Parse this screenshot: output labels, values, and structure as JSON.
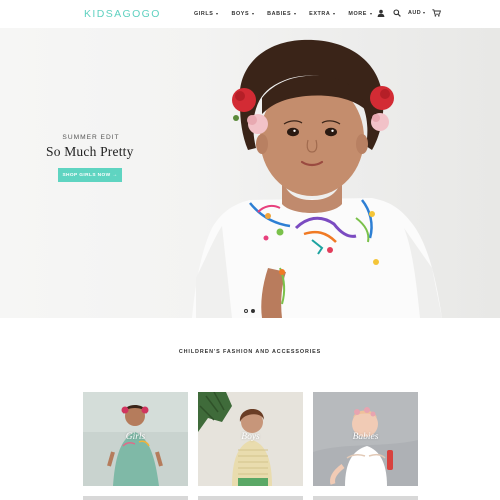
{
  "header": {
    "logo": "KIDSAGOGO",
    "nav": [
      {
        "label": "GIRLS"
      },
      {
        "label": "BOYS"
      },
      {
        "label": "BABIES"
      },
      {
        "label": "EXTRA"
      },
      {
        "label": "MORE"
      }
    ],
    "icons": [
      "user-icon",
      "search-icon",
      "cart-icon"
    ],
    "currency": "AUD"
  },
  "hero": {
    "kicker": "SUMMER EDIT",
    "title": "So Much Pretty",
    "cta": "SHOP GIRLS NOW →",
    "slides": 2,
    "active_slide": 1
  },
  "section": {
    "title": "CHILDREN'S FASHION AND ACCESSORIES",
    "cards": [
      {
        "label": "Girls"
      },
      {
        "label": "Boys"
      },
      {
        "label": "Babies"
      }
    ]
  },
  "colors": {
    "accent": "#5fd4c1",
    "logo": "#5fd1c0",
    "text": "#333333"
  }
}
